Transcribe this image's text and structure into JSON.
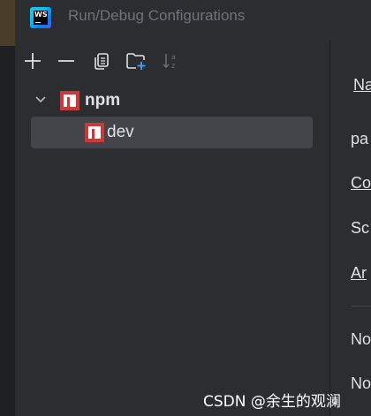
{
  "window": {
    "title": "Run/Debug Configurations",
    "logo_text": "WS"
  },
  "toolbar": {
    "add": "add-icon",
    "remove": "minus-icon",
    "copy": "copy-icon",
    "new_folder": "new-folder-icon",
    "sort": "sort-alphabetically-icon"
  },
  "tree": {
    "group": {
      "label": "npm",
      "expanded": true
    },
    "items": [
      {
        "label": "dev",
        "selected": true
      }
    ]
  },
  "right_panel": {
    "labels": [
      "Na",
      "pa",
      "Co",
      "Sc",
      "Ar",
      "No",
      "No"
    ]
  },
  "watermark": "CSDN @余生的观澜",
  "colors": {
    "background": "#2b2d30",
    "selection": "#43454a",
    "npm_red": "#cb3837",
    "text": "#dfe1e5",
    "title_text": "#6f737a"
  }
}
